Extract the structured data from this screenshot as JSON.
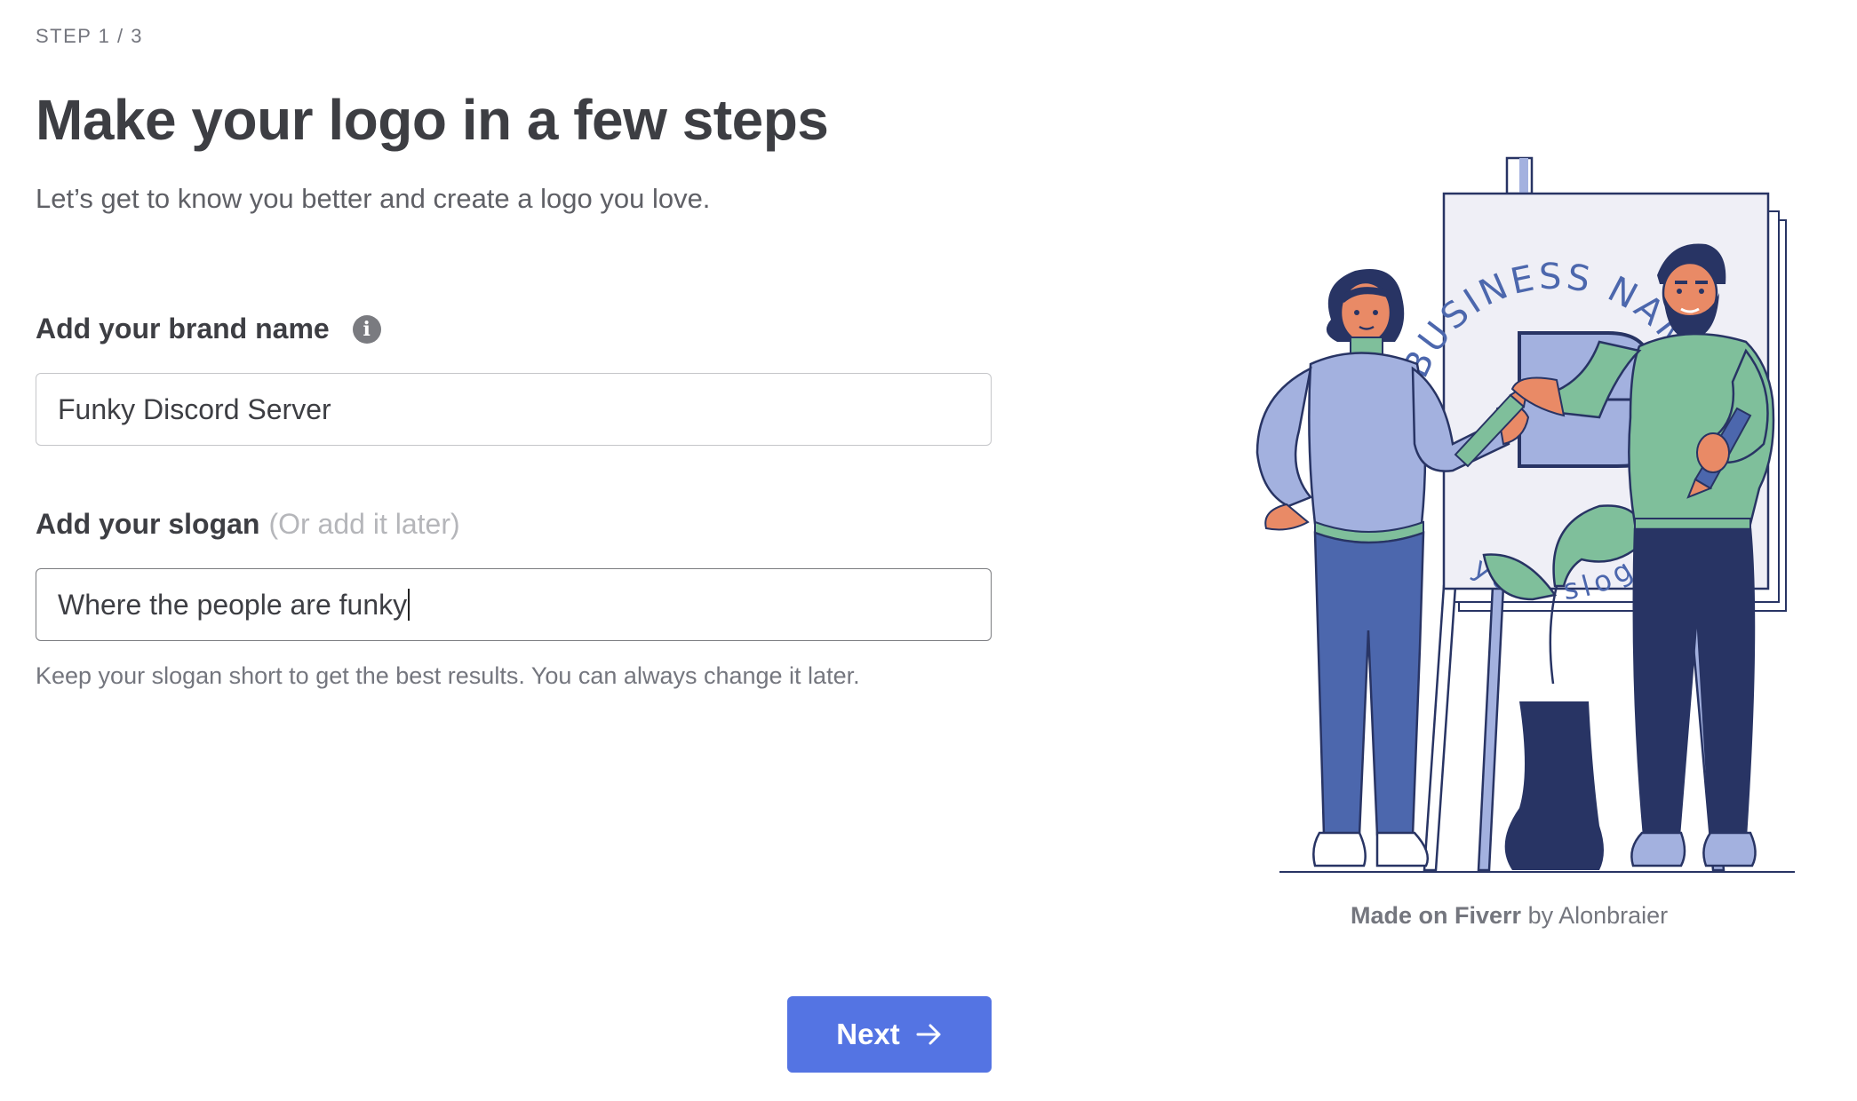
{
  "step": "STEP 1 / 3",
  "title": "Make your logo in a few steps",
  "subtitle": "Let’s get to know you better and create a logo you love.",
  "brand": {
    "label": "Add your brand name",
    "value": "Funky Discord Server"
  },
  "slogan": {
    "label": "Add your slogan",
    "optional": "(Or add it later)",
    "value": "Where the people are funky",
    "hint": "Keep your slogan short to get the best results. You can always change it later."
  },
  "illustration": {
    "sign_top": "BUSINESS NAME",
    "sign_bottom": "your slog",
    "sign_letter": "B"
  },
  "credit": {
    "made_on": "Made on Fiverr",
    "by": "by Alonbraier"
  },
  "next_button": {
    "label": "Next"
  },
  "colors": {
    "accent": "#5474e3",
    "person_left_top": "#a3b1df",
    "person_left_pants": "#4c67ad",
    "person_right_top": "#7fbf9b",
    "person_right_pants": "#283464"
  }
}
